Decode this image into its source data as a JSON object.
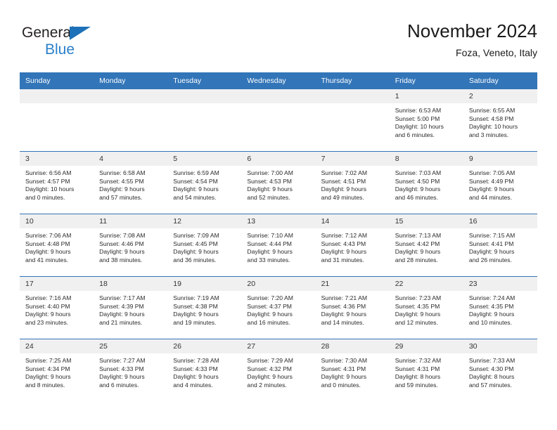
{
  "brand": {
    "line1": "General",
    "line2": "Blue",
    "triangle_color": "#1c71b9",
    "text_color": "#231f20",
    "blue_text_color": "#2a7fc9",
    "logo_icon": "triangle-flag-icon"
  },
  "header": {
    "month_title": "November 2024",
    "location": "Foza, Veneto, Italy"
  },
  "colors": {
    "header_blue": "#3275b8",
    "daynum_gray": "#f0f0f0",
    "cell_white": "#ffffff",
    "text": "#2b2b2b"
  },
  "calendar": {
    "weekday_headers": [
      "Sunday",
      "Monday",
      "Tuesday",
      "Wednesday",
      "Thursday",
      "Friday",
      "Saturday"
    ],
    "weeks": [
      [
        {
          "day": "",
          "blank": true,
          "lines": []
        },
        {
          "day": "",
          "blank": true,
          "lines": []
        },
        {
          "day": "",
          "blank": true,
          "lines": []
        },
        {
          "day": "",
          "blank": true,
          "lines": []
        },
        {
          "day": "",
          "blank": true,
          "lines": []
        },
        {
          "day": "1",
          "blank": false,
          "lines": [
            "Sunrise: 6:53 AM",
            "Sunset: 5:00 PM",
            "Daylight: 10 hours",
            "and 6 minutes."
          ]
        },
        {
          "day": "2",
          "blank": false,
          "lines": [
            "Sunrise: 6:55 AM",
            "Sunset: 4:58 PM",
            "Daylight: 10 hours",
            "and 3 minutes."
          ]
        }
      ],
      [
        {
          "day": "3",
          "blank": false,
          "lines": [
            "Sunrise: 6:56 AM",
            "Sunset: 4:57 PM",
            "Daylight: 10 hours",
            "and 0 minutes."
          ]
        },
        {
          "day": "4",
          "blank": false,
          "lines": [
            "Sunrise: 6:58 AM",
            "Sunset: 4:55 PM",
            "Daylight: 9 hours",
            "and 57 minutes."
          ]
        },
        {
          "day": "5",
          "blank": false,
          "lines": [
            "Sunrise: 6:59 AM",
            "Sunset: 4:54 PM",
            "Daylight: 9 hours",
            "and 54 minutes."
          ]
        },
        {
          "day": "6",
          "blank": false,
          "lines": [
            "Sunrise: 7:00 AM",
            "Sunset: 4:53 PM",
            "Daylight: 9 hours",
            "and 52 minutes."
          ]
        },
        {
          "day": "7",
          "blank": false,
          "lines": [
            "Sunrise: 7:02 AM",
            "Sunset: 4:51 PM",
            "Daylight: 9 hours",
            "and 49 minutes."
          ]
        },
        {
          "day": "8",
          "blank": false,
          "lines": [
            "Sunrise: 7:03 AM",
            "Sunset: 4:50 PM",
            "Daylight: 9 hours",
            "and 46 minutes."
          ]
        },
        {
          "day": "9",
          "blank": false,
          "lines": [
            "Sunrise: 7:05 AM",
            "Sunset: 4:49 PM",
            "Daylight: 9 hours",
            "and 44 minutes."
          ]
        }
      ],
      [
        {
          "day": "10",
          "blank": false,
          "lines": [
            "Sunrise: 7:06 AM",
            "Sunset: 4:48 PM",
            "Daylight: 9 hours",
            "and 41 minutes."
          ]
        },
        {
          "day": "11",
          "blank": false,
          "lines": [
            "Sunrise: 7:08 AM",
            "Sunset: 4:46 PM",
            "Daylight: 9 hours",
            "and 38 minutes."
          ]
        },
        {
          "day": "12",
          "blank": false,
          "lines": [
            "Sunrise: 7:09 AM",
            "Sunset: 4:45 PM",
            "Daylight: 9 hours",
            "and 36 minutes."
          ]
        },
        {
          "day": "13",
          "blank": false,
          "lines": [
            "Sunrise: 7:10 AM",
            "Sunset: 4:44 PM",
            "Daylight: 9 hours",
            "and 33 minutes."
          ]
        },
        {
          "day": "14",
          "blank": false,
          "lines": [
            "Sunrise: 7:12 AM",
            "Sunset: 4:43 PM",
            "Daylight: 9 hours",
            "and 31 minutes."
          ]
        },
        {
          "day": "15",
          "blank": false,
          "lines": [
            "Sunrise: 7:13 AM",
            "Sunset: 4:42 PM",
            "Daylight: 9 hours",
            "and 28 minutes."
          ]
        },
        {
          "day": "16",
          "blank": false,
          "lines": [
            "Sunrise: 7:15 AM",
            "Sunset: 4:41 PM",
            "Daylight: 9 hours",
            "and 26 minutes."
          ]
        }
      ],
      [
        {
          "day": "17",
          "blank": false,
          "lines": [
            "Sunrise: 7:16 AM",
            "Sunset: 4:40 PM",
            "Daylight: 9 hours",
            "and 23 minutes."
          ]
        },
        {
          "day": "18",
          "blank": false,
          "lines": [
            "Sunrise: 7:17 AM",
            "Sunset: 4:39 PM",
            "Daylight: 9 hours",
            "and 21 minutes."
          ]
        },
        {
          "day": "19",
          "blank": false,
          "lines": [
            "Sunrise: 7:19 AM",
            "Sunset: 4:38 PM",
            "Daylight: 9 hours",
            "and 19 minutes."
          ]
        },
        {
          "day": "20",
          "blank": false,
          "lines": [
            "Sunrise: 7:20 AM",
            "Sunset: 4:37 PM",
            "Daylight: 9 hours",
            "and 16 minutes."
          ]
        },
        {
          "day": "21",
          "blank": false,
          "lines": [
            "Sunrise: 7:21 AM",
            "Sunset: 4:36 PM",
            "Daylight: 9 hours",
            "and 14 minutes."
          ]
        },
        {
          "day": "22",
          "blank": false,
          "lines": [
            "Sunrise: 7:23 AM",
            "Sunset: 4:35 PM",
            "Daylight: 9 hours",
            "and 12 minutes."
          ]
        },
        {
          "day": "23",
          "blank": false,
          "lines": [
            "Sunrise: 7:24 AM",
            "Sunset: 4:35 PM",
            "Daylight: 9 hours",
            "and 10 minutes."
          ]
        }
      ],
      [
        {
          "day": "24",
          "blank": false,
          "lines": [
            "Sunrise: 7:25 AM",
            "Sunset: 4:34 PM",
            "Daylight: 9 hours",
            "and 8 minutes."
          ]
        },
        {
          "day": "25",
          "blank": false,
          "lines": [
            "Sunrise: 7:27 AM",
            "Sunset: 4:33 PM",
            "Daylight: 9 hours",
            "and 6 minutes."
          ]
        },
        {
          "day": "26",
          "blank": false,
          "lines": [
            "Sunrise: 7:28 AM",
            "Sunset: 4:33 PM",
            "Daylight: 9 hours",
            "and 4 minutes."
          ]
        },
        {
          "day": "27",
          "blank": false,
          "lines": [
            "Sunrise: 7:29 AM",
            "Sunset: 4:32 PM",
            "Daylight: 9 hours",
            "and 2 minutes."
          ]
        },
        {
          "day": "28",
          "blank": false,
          "lines": [
            "Sunrise: 7:30 AM",
            "Sunset: 4:31 PM",
            "Daylight: 9 hours",
            "and 0 minutes."
          ]
        },
        {
          "day": "29",
          "blank": false,
          "lines": [
            "Sunrise: 7:32 AM",
            "Sunset: 4:31 PM",
            "Daylight: 8 hours",
            "and 59 minutes."
          ]
        },
        {
          "day": "30",
          "blank": false,
          "lines": [
            "Sunrise: 7:33 AM",
            "Sunset: 4:30 PM",
            "Daylight: 8 hours",
            "and 57 minutes."
          ]
        }
      ]
    ]
  }
}
